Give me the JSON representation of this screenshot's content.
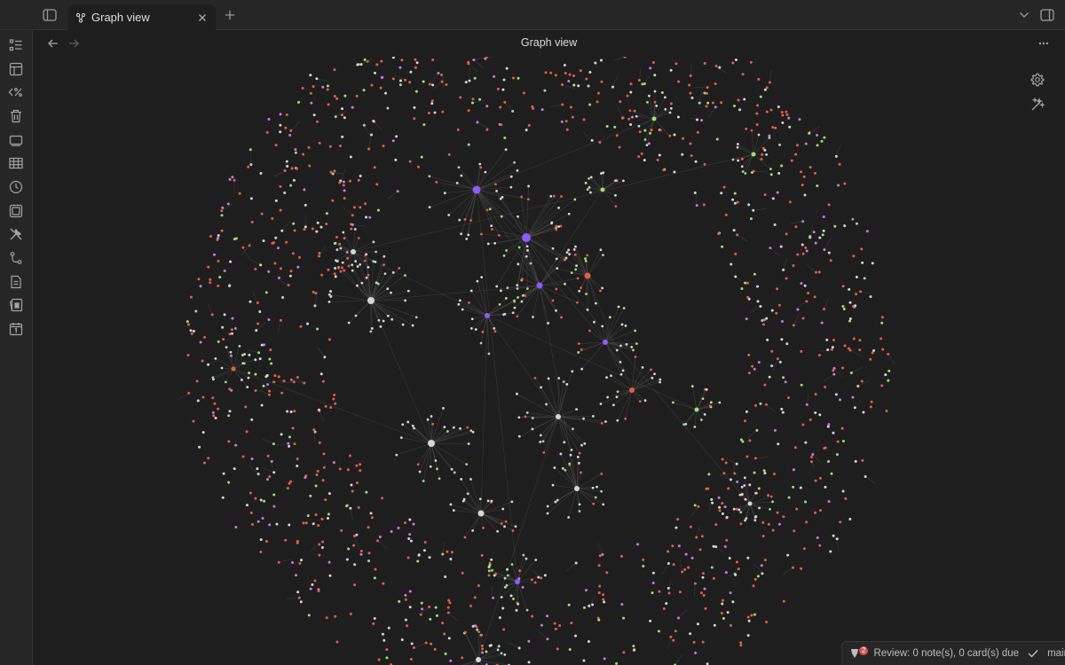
{
  "tabbar": {
    "tab_title": "Graph view",
    "tab_icon": "graph-icon"
  },
  "view": {
    "title": "Graph view"
  },
  "ribbon": {
    "icons": [
      "outline-list-icon",
      "layout-icon",
      "template-code-icon",
      "trash-icon",
      "slides-icon",
      "table-icon",
      "clock-icon",
      "stack-icon",
      "tools-icon",
      "git-branch-icon",
      "document-icon",
      "flashcards-icon",
      "calendar-icon"
    ]
  },
  "statusbar": {
    "review_badge": "2",
    "review_text": "Review: 0 note(s), 0 card(s) due",
    "branch": "main"
  },
  "colors": {
    "background": "#1e1e1e",
    "node_red": "#e5603e",
    "node_green": "#9be46b",
    "node_purple": "#c77ae8",
    "node_white": "#d6d6d6",
    "hub_purple": "#8b5cf6",
    "edge": "#555555"
  }
}
